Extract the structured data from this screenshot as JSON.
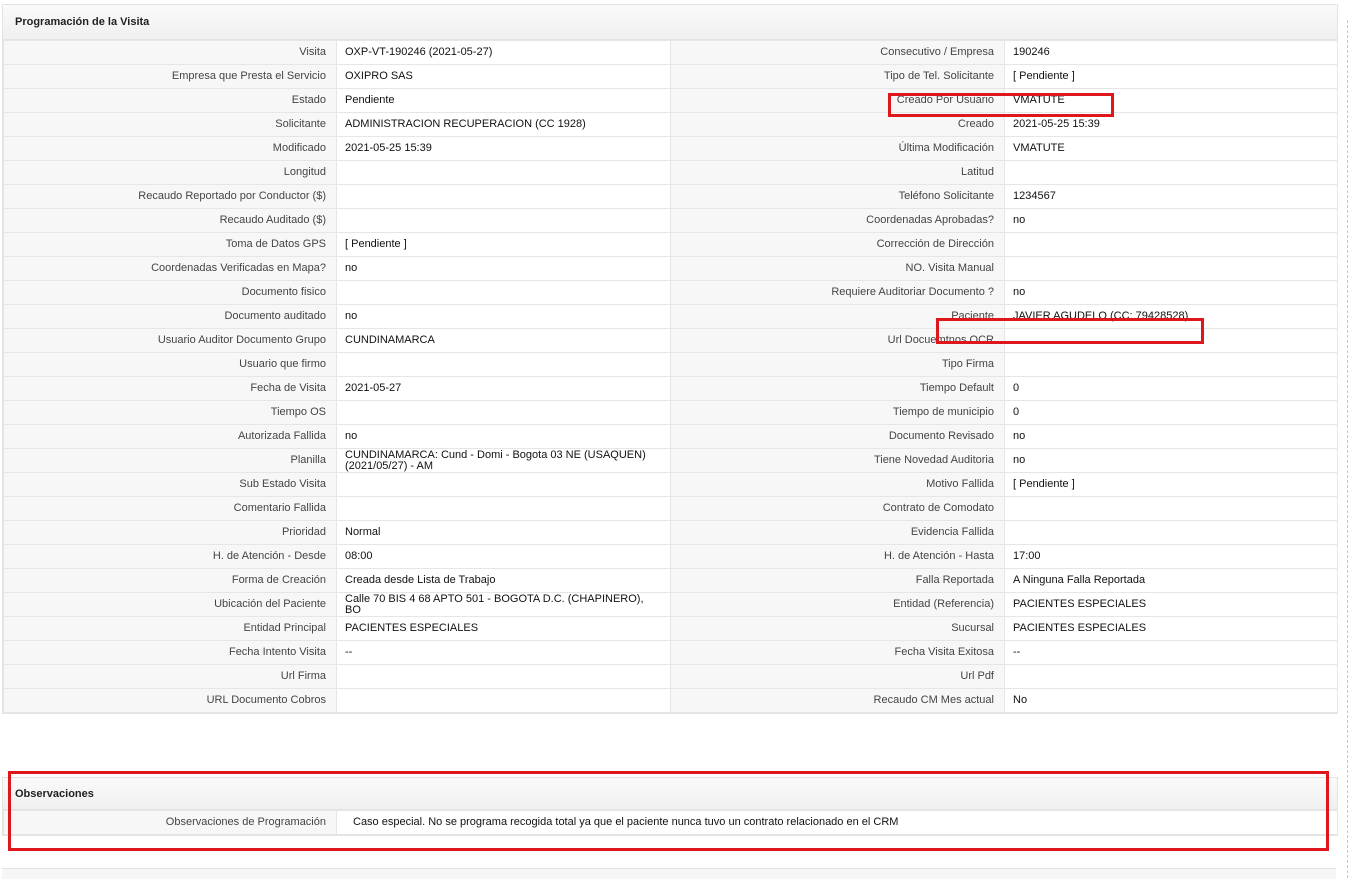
{
  "programacion": {
    "title": "Programación de la Visita",
    "rows": [
      {
        "l1": "Visita",
        "v1": "OXP-VT-190246 (2021-05-27)",
        "l2": "Consecutivo / Empresa",
        "v2": "190246"
      },
      {
        "l1": "Empresa que Presta el Servicio",
        "v1": "OXIPRO SAS",
        "l2": "Tipo de Tel. Solicitante",
        "v2": "[ Pendiente ]"
      },
      {
        "l1": "Estado",
        "v1": "Pendiente",
        "l2": "Creado Por Usuario",
        "v2": "VMATUTE"
      },
      {
        "l1": "Solicitante",
        "v1": "ADMINISTRACION RECUPERACION (CC 1928)",
        "l2": "Creado",
        "v2": "2021-05-25 15:39"
      },
      {
        "l1": "Modificado",
        "v1": "2021-05-25 15:39",
        "l2": "Última Modificación",
        "v2": " VMATUTE"
      },
      {
        "l1": "Longitud",
        "v1": "",
        "l2": "Latitud",
        "v2": ""
      },
      {
        "l1": "Recaudo Reportado por Conductor ($)",
        "v1": "",
        "l2": "Teléfono Solicitante",
        "v2": "1234567"
      },
      {
        "l1": "Recaudo Auditado ($)",
        "v1": "",
        "l2": "Coordenadas Aprobadas?",
        "v2": " no"
      },
      {
        "l1": "Toma de Datos GPS",
        "v1": "[ Pendiente ]",
        "l2": "Corrección de Dirección",
        "v2": ""
      },
      {
        "l1": "Coordenadas Verificadas en Mapa?",
        "v1": " no",
        "l2": "NO. Visita Manual",
        "v2": ""
      },
      {
        "l1": "Documento fisico",
        "v1": "",
        "l2": "Requiere Auditoriar Documento ?",
        "v2": " no"
      },
      {
        "l1": "Documento auditado",
        "v1": " no",
        "l2": "Paciente",
        "v2": "JAVIER AGUDELO (CC: 79428528)"
      },
      {
        "l1": "Usuario Auditor Documento Grupo",
        "v1": "CUNDINAMARCA",
        "l2": "Url Docuemtnos OCR",
        "v2": ""
      },
      {
        "l1": "Usuario que firmo",
        "v1": "",
        "l2": "Tipo Firma",
        "v2": ""
      },
      {
        "l1": "Fecha de Visita",
        "v1": " 2021-05-27",
        "l2": "Tiempo Default",
        "v2": "0"
      },
      {
        "l1": "Tiempo OS",
        "v1": "",
        "l2": "Tiempo de municipio",
        "v2": "0"
      },
      {
        "l1": "Autorizada Fallida",
        "v1": " no",
        "l2": "Documento Revisado",
        "v2": " no"
      },
      {
        "l1": "Planilla",
        "v1": "CUNDINAMARCA: Cund - Domi - Bogota 03 NE (USAQUEN) (2021/05/27) - AM",
        "l2": "Tiene Novedad Auditoria",
        "v2": " no"
      },
      {
        "l1": "Sub Estado Visita",
        "v1": "",
        "l2": "Motivo Fallida",
        "v2": "[ Pendiente ]"
      },
      {
        "l1": "Comentario Fallida",
        "v1": "",
        "l2": "Contrato de Comodato",
        "v2": ""
      },
      {
        "l1": "Prioridad",
        "v1": "Normal",
        "l2": "Evidencia Fallida",
        "v2": ""
      },
      {
        "l1": "H. de Atención - Desde",
        "v1": "08:00",
        "l2": "H. de Atención - Hasta",
        "v2": "17:00"
      },
      {
        "l1": "Forma de Creación",
        "v1": "Creada desde Lista de Trabajo",
        "l2": "Falla Reportada",
        "v2": "A Ninguna Falla Reportada"
      },
      {
        "l1": "Ubicación del Paciente",
        "v1": "Calle 70 BIS 4 68 APTO 501 - BOGOTA D.C. (CHAPINERO), BO",
        "l2": "Entidad (Referencia)",
        "v2": "PACIENTES ESPECIALES"
      },
      {
        "l1": "Entidad Principal",
        "v1": "PACIENTES ESPECIALES",
        "l2": "Sucursal",
        "v2": "PACIENTES ESPECIALES"
      },
      {
        "l1": "Fecha Intento Visita",
        "v1": " --",
        "l2": "Fecha Visita Exitosa",
        "v2": " --"
      },
      {
        "l1": "Url Firma",
        "v1": "",
        "l2": "Url Pdf",
        "v2": ""
      },
      {
        "l1": "URL Documento Cobros",
        "v1": "",
        "l2": "Recaudo CM Mes actual",
        "v2": "No"
      }
    ]
  },
  "observaciones": {
    "title": "Observaciones",
    "label": "Observaciones de Programación",
    "value": "Caso especial. No se programa recogida total ya que el paciente nunca tuvo un contrato relacionado en el CRM"
  },
  "colors": {
    "annotation": "#e0161d",
    "label_bg": "#f7f7f7",
    "border": "#e6e6e6"
  }
}
